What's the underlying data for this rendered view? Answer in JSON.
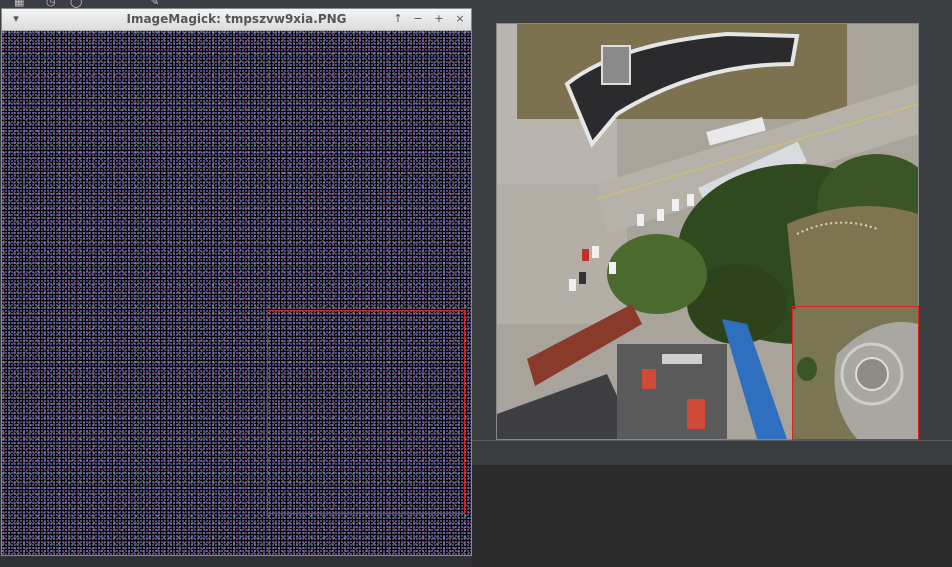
{
  "window": {
    "title": "ImageMagick: tmpszvw9xia.PNG",
    "menu_icon": "chevron-down-icon",
    "buttons": {
      "up": "↑",
      "minimize": "−",
      "maximize": "+",
      "close": "×"
    }
  },
  "top_strip_icons": [
    "grid-icon",
    "clock-icon",
    "search-icon",
    "pen-icon"
  ],
  "colors": {
    "selection_box": "#e02020",
    "title_text": "#555555"
  }
}
